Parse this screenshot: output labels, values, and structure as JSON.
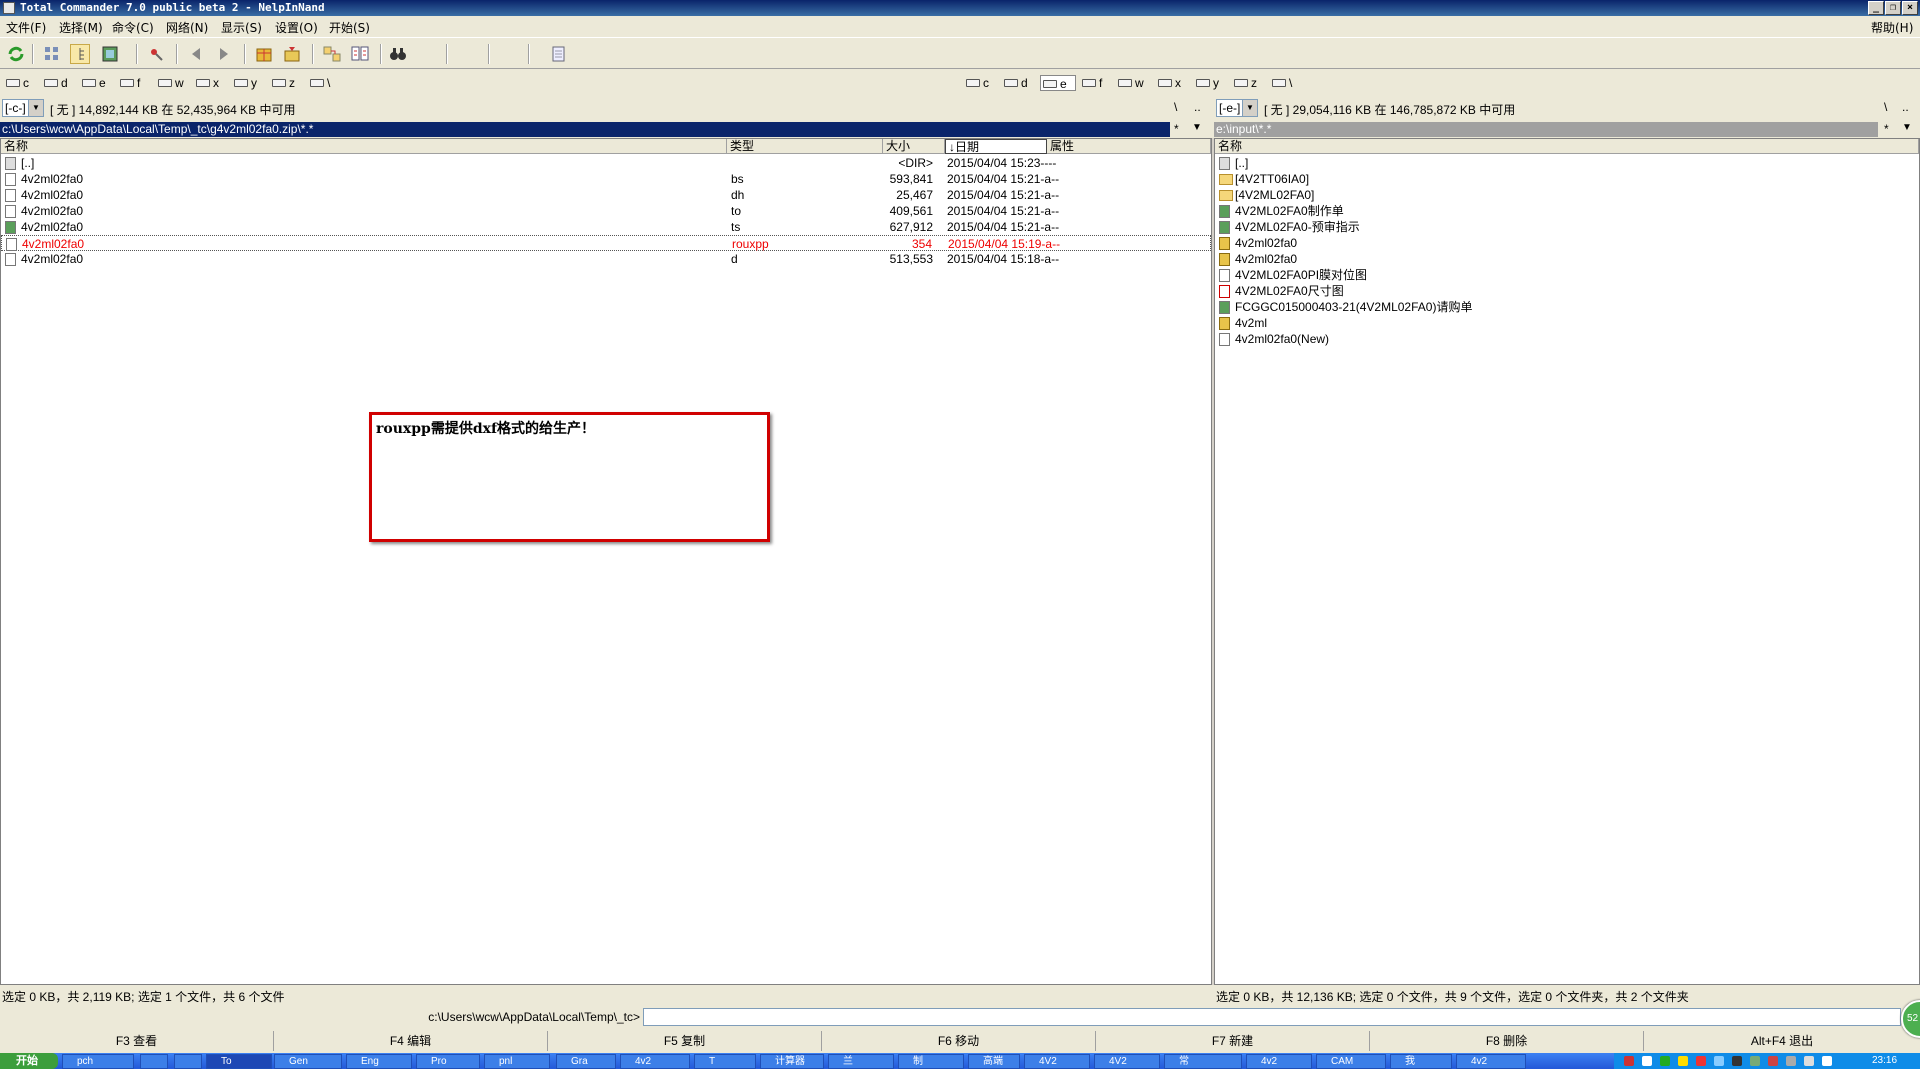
{
  "window": {
    "title": "Total Commander 7.0 public beta 2 - NelpInNand"
  },
  "menu": {
    "items": [
      "文件(F)",
      "选择(M)",
      "命令(C)",
      "网络(N)",
      "显示(S)",
      "设置(O)",
      "开始(S)"
    ],
    "help": "帮助(H)"
  },
  "toolbar": {
    "icons": [
      "refresh-icon",
      "icons-view-icon",
      "tree-view-icon",
      "thumbnail-view-icon",
      "pack-icon",
      "back-icon",
      "forward-icon",
      "pack-files-icon",
      "unpack-files-icon",
      "sync-dirs-icon",
      "compare-icon",
      "find-icon",
      "notepad-icon"
    ]
  },
  "left": {
    "drives": [
      "c",
      "d",
      "e",
      "f",
      "w",
      "x",
      "y",
      "z",
      "\\"
    ],
    "active_drive": "c",
    "combo": "[-c-]",
    "free": "[ 无 ]  14,892,144 KB 在 52,435,964 KB 中可用",
    "root_btn": "\\",
    "up_btn": "..",
    "path": "c:\\Users\\wcw\\AppData\\Local\\Temp\\_tc\\g4v2ml02fa0.zip\\*.*",
    "filter": "*",
    "headers": {
      "name": "名称",
      "type": "类型",
      "size": "大小",
      "date": "↓日期",
      "attr": "属性"
    },
    "rows": [
      {
        "icon": "up",
        "name": "[..]",
        "type": "",
        "size": "<DIR>",
        "date": "2015/04/04 15:23----",
        "sel": false
      },
      {
        "icon": "file",
        "name": "4v2ml02fa0",
        "type": "bs",
        "size": "593,841",
        "date": "2015/04/04 15:21-a--",
        "sel": false
      },
      {
        "icon": "file",
        "name": "4v2ml02fa0",
        "type": "dh",
        "size": "25,467",
        "date": "2015/04/04 15:21-a--",
        "sel": false
      },
      {
        "icon": "file",
        "name": "4v2ml02fa0",
        "type": "to",
        "size": "409,561",
        "date": "2015/04/04 15:21-a--",
        "sel": false
      },
      {
        "icon": "exe",
        "name": "4v2ml02fa0",
        "type": "ts",
        "size": "627,912",
        "date": "2015/04/04 15:21-a--",
        "sel": false
      },
      {
        "icon": "file",
        "name": "4v2ml02fa0",
        "type": "rouxpp",
        "size": "354",
        "date": "2015/04/04 15:19-a--",
        "sel": true
      },
      {
        "icon": "file",
        "name": "4v2ml02fa0",
        "type": "d",
        "size": "513,553",
        "date": "2015/04/04 15:18-a--",
        "sel": false
      }
    ],
    "status": "选定 0 KB，共 2,119 KB; 选定 1 个文件，共 6 个文件"
  },
  "right": {
    "drives": [
      "c",
      "d",
      "e",
      "f",
      "w",
      "x",
      "y",
      "z",
      "\\"
    ],
    "active_drive": "e",
    "combo": "[-e-]",
    "free": "[ 无 ]  29,054,116 KB 在 146,785,872 KB 中可用",
    "root_btn": "\\",
    "up_btn": "..",
    "path": "e:\\input\\*.*",
    "filter": "*",
    "headers": {
      "name": "名称"
    },
    "rows": [
      {
        "icon": "up",
        "name": "[..]"
      },
      {
        "icon": "folder",
        "name": "[4V2TT06IA0]"
      },
      {
        "icon": "folder",
        "name": "[4V2ML02FA0]"
      },
      {
        "icon": "exe",
        "name": "4V2ML02FA0制作单"
      },
      {
        "icon": "exe",
        "name": "4V2ML02FA0-预审指示"
      },
      {
        "icon": "pkg",
        "name": "4v2ml02fa0"
      },
      {
        "icon": "pkg",
        "name": "4v2ml02fa0"
      },
      {
        "icon": "file",
        "name": "4V2ML02FA0PI膜对位图"
      },
      {
        "icon": "pdf",
        "name": "4V2ML02FA0尺寸图"
      },
      {
        "icon": "exe",
        "name": "FCGGC015000403-21(4V2ML02FA0)请购单"
      },
      {
        "icon": "pkg",
        "name": "4v2ml"
      },
      {
        "icon": "file",
        "name": "4v2ml02fa0(New)"
      }
    ],
    "status": "选定 0 KB，共 12,136 KB; 选定 0 个文件，共 9 个文件，选定 0 个文件夹，共 2 个文件夹"
  },
  "note": {
    "text": "rouxpp需提供dxf格式的给生产！"
  },
  "cmdline": {
    "label": "c:\\Users\\wcw\\AppData\\Local\\Temp\\_tc>",
    "value": ""
  },
  "fkeys": [
    "F3 查看",
    "F4 编辑",
    "F5 复制",
    "F6 移动",
    "F7 新建",
    "F8 删除",
    "Alt+F4 退出"
  ],
  "taskbar": {
    "start": "开始",
    "tasks": [
      "pch",
      "",
      "",
      "To",
      "Gen",
      "Eng",
      "Pro",
      "pnl",
      "Gra",
      "4v2",
      "T",
      "计算器",
      "兰",
      "制",
      "高端",
      "4V2",
      "4V2",
      "常",
      "4v2",
      "CAM",
      "我",
      "4v2"
    ],
    "clock": "23:16"
  },
  "bubble": {
    "text": "52"
  },
  "colors": {
    "accent": "#0a246a",
    "selected_text": "#e00000",
    "note_border": "#d00000"
  }
}
